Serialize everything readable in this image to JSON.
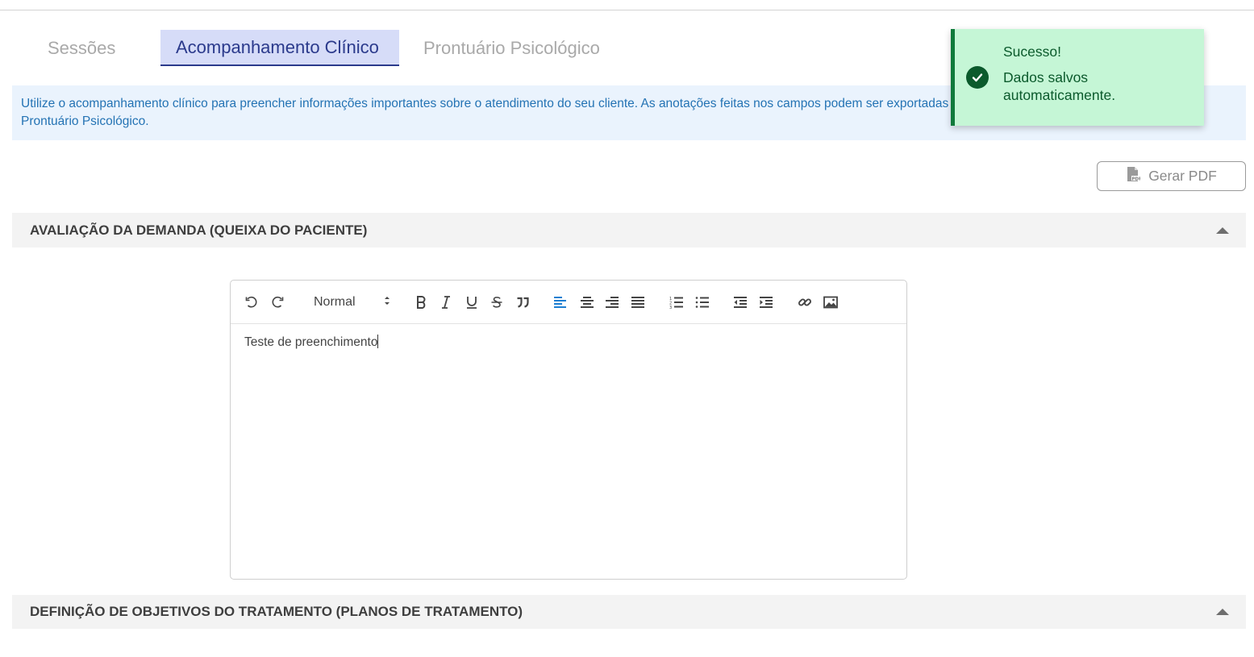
{
  "tabs": [
    {
      "label": "Sessões",
      "active": false
    },
    {
      "label": "Acompanhamento Clínico",
      "active": true
    },
    {
      "label": "Prontuário Psicológico",
      "active": false
    }
  ],
  "info_banner": {
    "text": "Utilize o acompanhamento clínico para preencher informações importantes sobre o atendimento do seu cliente. As anotações feitas nos campos podem ser exportadas para o Prontuário Psicológico.",
    "line1": "Utilize o acompanhamento clínico para preencher informações importantes sobre o atendimento do seu cliente. As anotações feitas nos campos podem ser exportadas para o",
    "line2": "Prontuário Psicológico."
  },
  "toast": {
    "title": "Sucesso!",
    "message": "Dados salvos automaticamente.",
    "icon": "check-circle-icon",
    "color": "#0b5a2c",
    "background": "#c5f6d6"
  },
  "pdf_button": {
    "label": "Gerar PDF",
    "icon": "pdf-file-icon"
  },
  "sections": [
    {
      "title": "AVALIAÇÃO DA DEMANDA (QUEIXA DO PACIENTE)",
      "expanded": true
    },
    {
      "title": "DEFINIÇÃO DE OBJETIVOS DO TRATAMENTO (PLANOS DE TRATAMENTO)",
      "expanded": true
    }
  ],
  "editor": {
    "header_select": "Normal",
    "content": "Teste de preenchimento",
    "toolbar": [
      "undo-icon",
      "redo-icon",
      "bold-icon",
      "italic-icon",
      "underline-icon",
      "strikethrough-icon",
      "blockquote-icon",
      "align-left-icon",
      "align-center-icon",
      "align-right-icon",
      "align-justify-icon",
      "ordered-list-icon",
      "bullet-list-icon",
      "outdent-icon",
      "indent-icon",
      "link-icon",
      "image-icon"
    ],
    "active_color": "#1f7fd1"
  }
}
